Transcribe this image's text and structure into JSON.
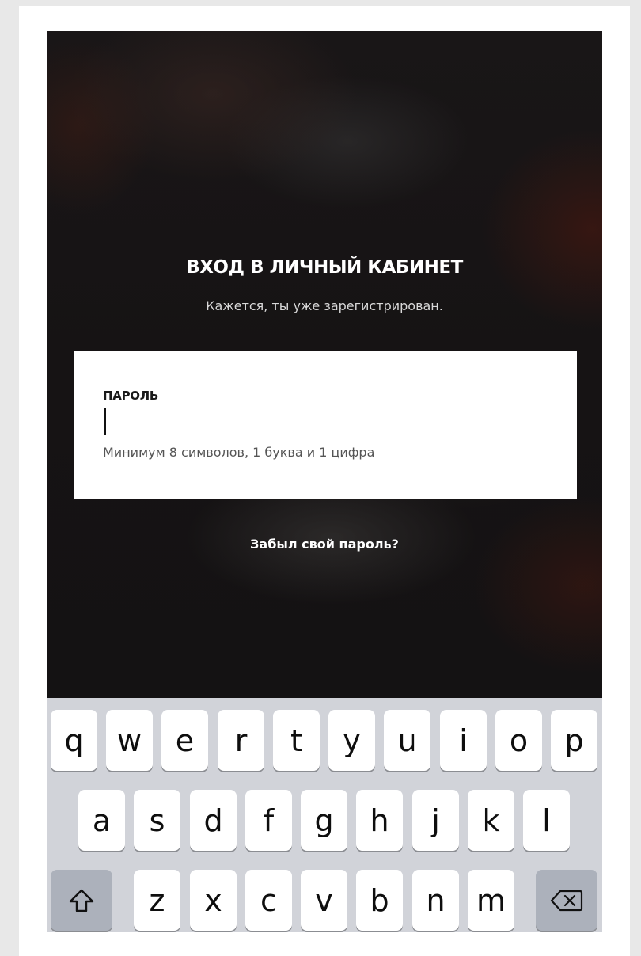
{
  "login": {
    "title": "ВХОД В ЛИЧНЫЙ КАБИНЕТ",
    "subtitle": "Кажется, ты уже зарегистрирован.",
    "password_label": "ПАРОЛЬ",
    "password_value": "",
    "password_hint": "Минимум 8 символов, 1 буква и 1 цифра",
    "forgot_link": "Забыл свой пароль?"
  },
  "keyboard": {
    "row1": [
      "q",
      "w",
      "e",
      "r",
      "t",
      "y",
      "u",
      "i",
      "o",
      "p"
    ],
    "row2": [
      "a",
      "s",
      "d",
      "f",
      "g",
      "h",
      "j",
      "k",
      "l"
    ],
    "row3": [
      "z",
      "x",
      "c",
      "v",
      "b",
      "n",
      "m"
    ],
    "shift_icon": "shift-arrow-icon",
    "backspace_icon": "backspace-icon"
  },
  "colors": {
    "background": "#141213",
    "card": "#ffffff",
    "keyboard": "#d1d3d9",
    "special_key": "#acb1bb"
  }
}
